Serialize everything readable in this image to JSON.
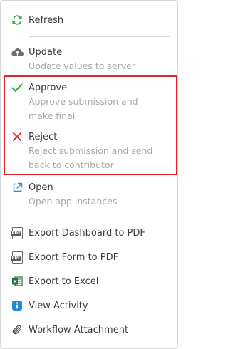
{
  "menu": {
    "refresh": {
      "label": "Refresh",
      "icon": "refresh-icon",
      "color": "#2aa84a"
    },
    "update": {
      "label": "Update",
      "description": "Update values to server",
      "icon": "cloud-upload-icon"
    },
    "approve": {
      "label": "Approve",
      "description_line1": "Approve submission and",
      "description_line2": "make final",
      "icon": "checkmark-icon",
      "color": "#2aa84a"
    },
    "reject": {
      "label": "Reject",
      "description_line1": "Reject submission and send",
      "description_line2": "back to contributor",
      "icon": "x-icon",
      "color": "#e0242b"
    },
    "open": {
      "label": "Open",
      "description": "Open app instances",
      "icon": "external-link-icon",
      "color": "#2e8bd6"
    },
    "export_dashboard": {
      "label": "Export Dashboard to PDF",
      "icon": "pdf-file-icon",
      "badge": "PDF"
    },
    "export_form": {
      "label": "Export Form to PDF",
      "icon": "pdf-file-icon",
      "badge": "PDF"
    },
    "export_excel": {
      "label": "Export to Excel",
      "icon": "excel-icon",
      "color": "#1e7145"
    },
    "view_activity": {
      "label": "View Activity",
      "icon": "info-icon",
      "color": "#1a8bd8"
    },
    "workflow_attachment": {
      "label": "Workflow Attachment",
      "icon": "paperclip-icon"
    }
  },
  "highlight_color": "#e0242b"
}
